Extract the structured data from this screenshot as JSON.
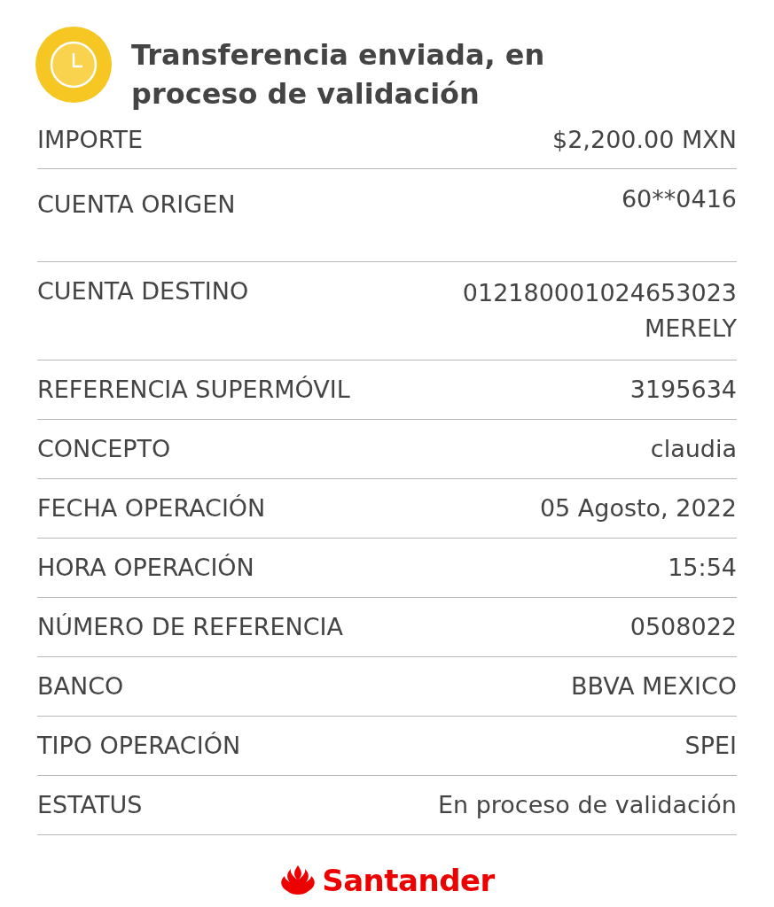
{
  "header": {
    "title": "Transferencia enviada, en proceso de validación"
  },
  "rows": [
    {
      "label": "IMPORTE",
      "values": [
        "$2,200.00 MXN"
      ]
    },
    {
      "label": "CUENTA ORIGEN",
      "values": [
        "60**0416"
      ]
    },
    {
      "label": "CUENTA DESTINO",
      "values": [
        "012180001024653023",
        "MERELY"
      ]
    },
    {
      "label": "REFERENCIA SUPERMÓVIL",
      "values": [
        "3195634"
      ]
    },
    {
      "label": "CONCEPTO",
      "values": [
        "claudia"
      ]
    },
    {
      "label": "FECHA OPERACIÓN",
      "values": [
        "05 Agosto, 2022"
      ]
    },
    {
      "label": "HORA OPERACIÓN",
      "values": [
        "15:54"
      ]
    },
    {
      "label": "NÚMERO DE REFERENCIA",
      "values": [
        "0508022"
      ]
    },
    {
      "label": "BANCO",
      "values": [
        "BBVA MEXICO"
      ]
    },
    {
      "label": "TIPO OPERACIÓN",
      "values": [
        "SPEI"
      ]
    },
    {
      "label": "ESTATUS",
      "values": [
        "En proceso de validación"
      ]
    }
  ],
  "footer": {
    "brand": "Santander"
  }
}
